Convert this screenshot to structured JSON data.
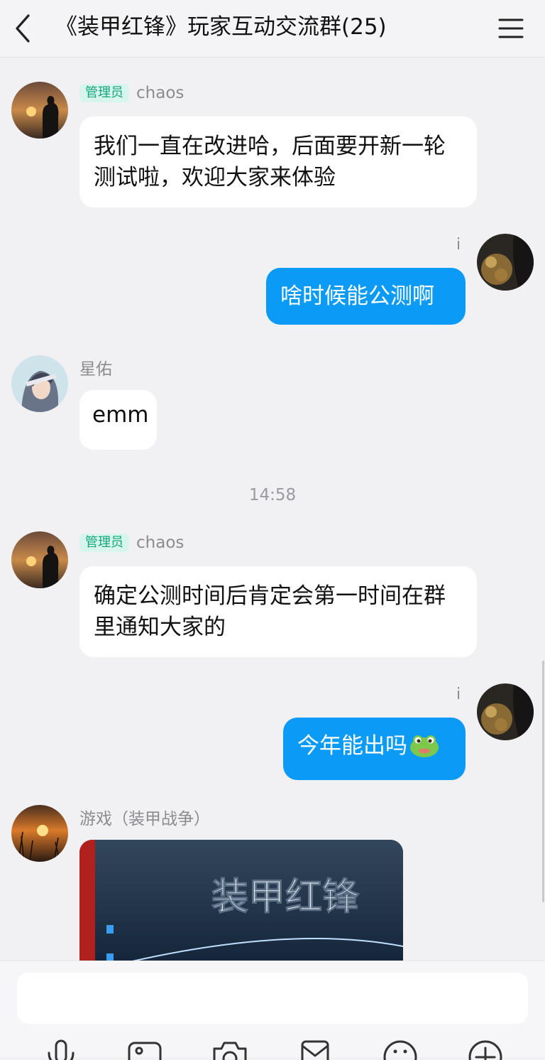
{
  "header": {
    "title": "《装甲红锋》玩家互动交流群(25)"
  },
  "messages": [
    {
      "sender": "chaos",
      "badge": "管理员",
      "text": "我们一直在改进哈，后面要开新一轮测试啦，欢迎大家来体验"
    },
    {
      "sender": "i",
      "text": "啥时候能公测啊"
    },
    {
      "sender": "星佑",
      "text": "emm"
    },
    {
      "sender": "chaos",
      "badge": "管理员",
      "text": "确定公测时间后肯定会第一时间在群里通知大家的"
    },
    {
      "sender": "i",
      "text": "今年能出吗"
    },
    {
      "sender": "游戏（装甲战争）",
      "image_text": "装甲红锋"
    }
  ],
  "timestamp": "14:58",
  "colors": {
    "outgoing_bubble": "#0b9bf7",
    "admin_badge_bg": "#d7f5ec",
    "admin_badge_text": "#14a67b"
  },
  "icons": [
    "back-icon",
    "menu-icon",
    "voice-icon",
    "image-icon",
    "camera-icon",
    "red-packet-icon",
    "emoji-icon",
    "plus-icon"
  ]
}
